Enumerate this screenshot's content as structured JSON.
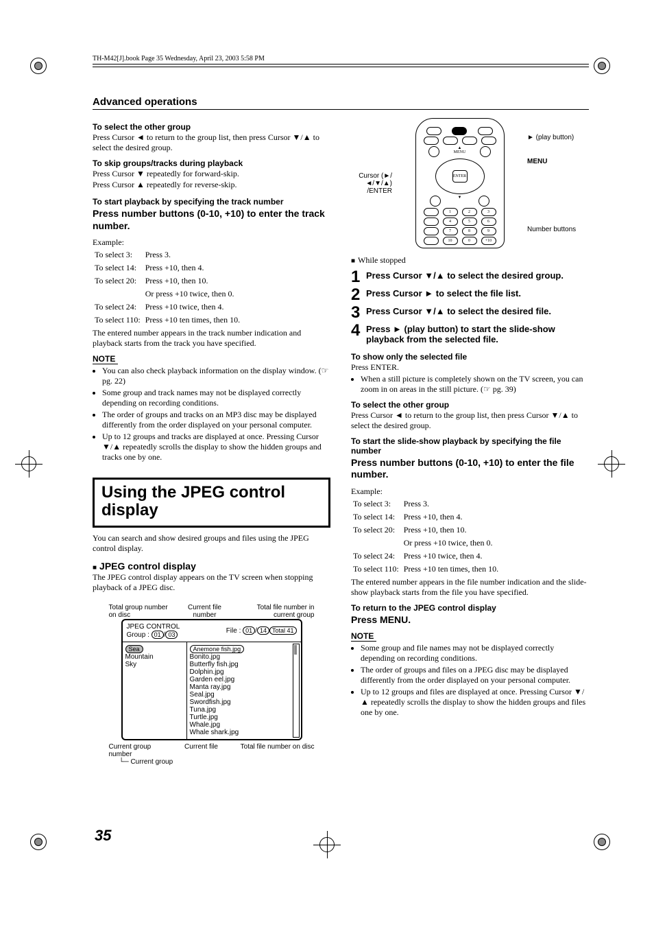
{
  "header": {
    "stamp": "TH-M42[J].book  Page 35  Wednesday, April 23, 2003  5:58 PM"
  },
  "section_title": "Advanced operations",
  "left": {
    "h1": "To select the other group",
    "p1": "Press Cursor ◄ to return to the group list, then press Cursor ▼/▲ to select the desired group.",
    "h2": "To skip groups/tracks during playback",
    "p2a": "Press Cursor ▼ repeatedly for forward-skip.",
    "p2b": "Press Cursor ▲ repeatedly for reverse-skip.",
    "h3": "To start playback by specifying the track number",
    "instr": "Press number buttons (0-10, +10) to enter the track number.",
    "ex_label": "Example:",
    "ex": [
      [
        "To select 3:",
        "Press 3."
      ],
      [
        "To select 14:",
        "Press +10, then 4."
      ],
      [
        "To select 20:",
        "Press +10, then 10."
      ],
      [
        "",
        "Or press +10 twice, then 0."
      ],
      [
        "To select 24:",
        "Press +10 twice, then 4."
      ],
      [
        "To select 110:",
        "Press +10 ten times, then 10."
      ]
    ],
    "after_ex": "The entered number appears in the track number indication and playback starts from the track you have specified.",
    "note_label": "NOTE",
    "notes": [
      "You can also check playback information on the display window. (☞ pg. 22)",
      "Some group and track names may not be displayed correctly depending on recording conditions.",
      "The order of groups and tracks on an MP3 disc may be displayed differently from the order displayed on your personal computer.",
      "Up to 12 groups and tracks are displayed at once. Pressing Cursor ▼/▲ repeatedly scrolls the display to show the hidden groups and tracks one by one."
    ],
    "big_title": "Using the JPEG control display",
    "big_sub": "You can search and show desired groups and files using the JPEG control display.",
    "jpeg_h": "JPEG control display",
    "jpeg_p": "The JPEG control display appears on the TV screen when stopping playback of a JPEG disc.",
    "anno_top_left": "Total group number on disc",
    "anno_top_mid": "Current file number",
    "anno_top_right": "Total file number in current group",
    "panel_title": "JPEG CONTROL",
    "group_label": "Group :",
    "group_cur": "01",
    "group_total": "03",
    "file_label": "File :",
    "file_cur": "01",
    "file_curgrp": "14",
    "file_total": "Total 41",
    "groups": [
      "Sea",
      "Mountain",
      "Sky"
    ],
    "files": [
      "Anemone fish.jpg",
      "Bonito.jpg",
      "Butterfly fish.jpg",
      "Dolphin.jpg",
      "Garden eel.jpg",
      "Manta ray.jpg",
      "Seal.jpg",
      "Swordfish.jpg",
      "Tuna.jpg",
      "Turtle.jpg",
      "Whale.jpg",
      "Whale shark.jpg"
    ],
    "anno_bot_a": "Current group number",
    "anno_bot_b": "Current file",
    "anno_bot_c": "Total file number on disc",
    "anno_bot_d": "Current group"
  },
  "right": {
    "label_play": "► (play button)",
    "label_menu": "MENU",
    "label_cursor": "Cursor (►/◄/▼/▲) /ENTER",
    "label_num": "Number buttons",
    "while_stopped": "While stopped",
    "steps": [
      "Press Cursor ▼/▲ to select the desired group.",
      "Press Cursor ► to select the file list.",
      "Press Cursor ▼/▲ to select the desired file.",
      "Press ► (play button) to start the slide-show playback from the selected file."
    ],
    "show_h": "To show only the selected file",
    "show_p1": "Press ENTER.",
    "show_b1": "When a still picture is completely shown on the TV screen, you can zoom in on areas in the still picture. (☞ pg. 39)",
    "sel_h": "To select the other group",
    "sel_p": "Press Cursor ◄ to return to the group list, then press Cursor ▼/▲ to select the desired group.",
    "start_h": "To start the slide-show playback by specifying the file number",
    "start_instr": "Press number buttons (0-10, +10) to enter the file number.",
    "ex_label": "Example:",
    "ex": [
      [
        "To select 3:",
        "Press 3."
      ],
      [
        "To select 14:",
        "Press +10, then 4."
      ],
      [
        "To select 20:",
        "Press +10, then 10."
      ],
      [
        "",
        "Or press +10 twice, then 0."
      ],
      [
        "To select 24:",
        "Press +10 twice, then 4."
      ],
      [
        "To select 110:",
        "Press +10 ten times, then 10."
      ]
    ],
    "after_ex": "The entered number appears in the file number indication and the slide-show playback starts from the file you have specified.",
    "return_h": "To return to the JPEG control display",
    "return_instr": "Press MENU.",
    "note_label": "NOTE",
    "notes": [
      "Some group and file names may not be displayed correctly depending on recording conditions.",
      "The order of groups and files on a JPEG disc may be displayed differently from the order displayed on your personal computer.",
      "Up to 12 groups and files are displayed at once. Pressing Cursor ▼/▲ repeatedly scrolls the display to show the hidden groups and files one by one."
    ]
  },
  "page_number": "35"
}
